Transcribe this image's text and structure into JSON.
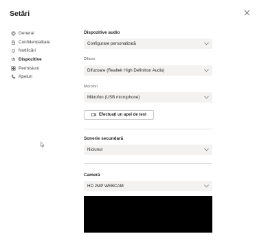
{
  "dialog": {
    "title": "Setări"
  },
  "nav": {
    "items": [
      {
        "label": "General",
        "icon": "gear-icon",
        "active": false
      },
      {
        "label": "Confidențialitate",
        "icon": "lock-icon",
        "active": false
      },
      {
        "label": "Notificări",
        "icon": "bell-icon",
        "active": false
      },
      {
        "label": "Dispozitive",
        "icon": "device-icon",
        "active": true
      },
      {
        "label": "Permisiuni",
        "icon": "permissions-icon",
        "active": false
      },
      {
        "label": "Apeluri",
        "icon": "phone-icon",
        "active": false
      }
    ]
  },
  "audio": {
    "title": "Dispozitive audio",
    "profile": "Configurare personalizată",
    "speaker_label": "Difuzor",
    "speaker": "Difuzoare (Realtek High Definition Audio)",
    "mic_label": "Microfon",
    "mic": "Mikrofon (USB microphone)",
    "test_call": "Efectuați un apel de test"
  },
  "ringer": {
    "title": "Sonerie secundară",
    "value": "Niciunul"
  },
  "camera": {
    "title": "Cameră",
    "value": "HD 2MP WEBCAM"
  }
}
